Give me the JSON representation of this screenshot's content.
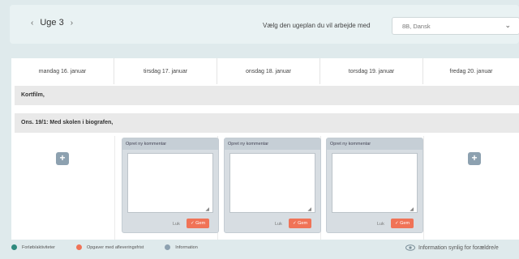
{
  "header": {
    "week_label": "Uge 3",
    "prev_icon": "chevron-left-icon",
    "next_icon": "chevron-right-icon",
    "select_label": "Vælg den ugeplan du vil arbejde med",
    "select_value": "8B, Dansk"
  },
  "days": [
    {
      "label": "mandag 16. januar"
    },
    {
      "label": "tirsdag 17. januar"
    },
    {
      "label": "onsdag 18. januar"
    },
    {
      "label": "torsdag 19. januar"
    },
    {
      "label": "fredag 20. januar"
    }
  ],
  "banners": [
    {
      "text": "Kortfilm,"
    },
    {
      "text": "Ons. 19/1: Med skolen i biografen,"
    }
  ],
  "comment_card": {
    "title": "Opret ny kommentar",
    "close_label": "Luk",
    "save_label": "✓ Gem"
  },
  "legend": [
    {
      "label": "Forløb/aktiviteter",
      "color": "#2f8a7e"
    },
    {
      "label": "Opgaver med afleveringsfrist",
      "color": "#f07357"
    },
    {
      "label": "Information",
      "color": "#8da1b0"
    }
  ],
  "visibility_text": "Information synlig for forældre/e",
  "colors": {
    "accent": "#f07357",
    "add_button": "#8da1b0"
  }
}
